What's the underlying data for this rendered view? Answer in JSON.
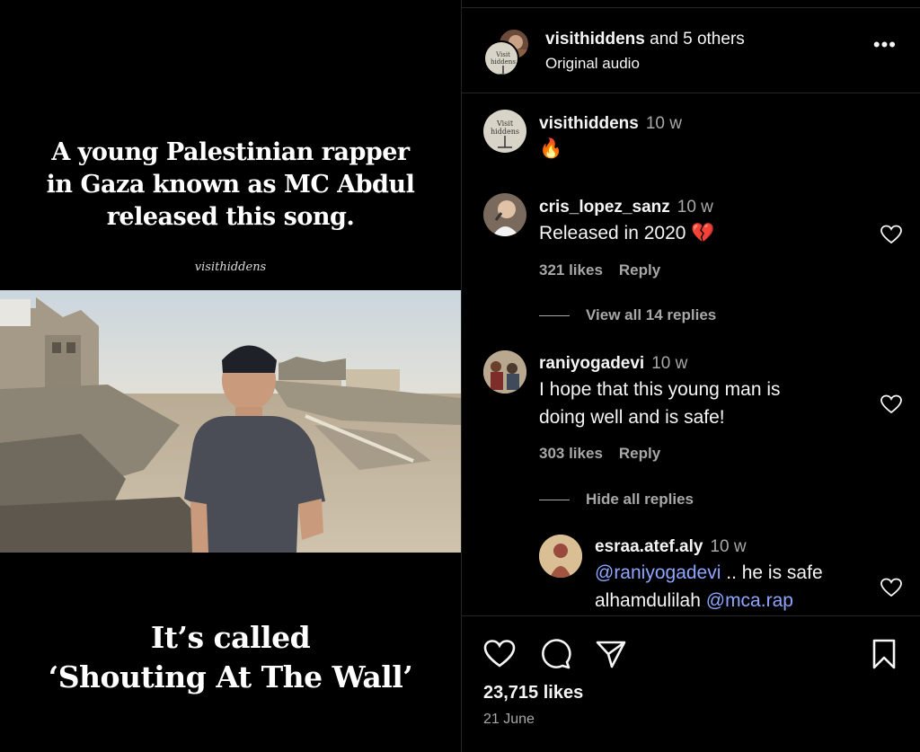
{
  "post": {
    "headline_lines": [
      "A young Palestinian rapper",
      "in Gaza known as MC Abdul",
      "released this song."
    ],
    "brand": "visithiddens",
    "footer_lines": [
      "It’s called",
      "‘Shouting At The Wall’"
    ]
  },
  "header": {
    "user": "visithiddens",
    "and_others": "and 5 others",
    "audio": "Original audio",
    "more_icon": "more-horizontal-icon"
  },
  "comments": [
    {
      "user": "visithiddens",
      "time": "10 w",
      "text": "🔥"
    },
    {
      "user": "cris_lopez_sanz",
      "time": "10 w",
      "text": "Released in 2020 💔",
      "likes": "321 likes",
      "reply": "Reply",
      "thread": "View all 14 replies"
    },
    {
      "user": "raniyogadevi",
      "time": "10 w",
      "text_lines": [
        "I hope that this young man is",
        "doing well and is safe!"
      ],
      "likes": "303 likes",
      "reply": "Reply",
      "thread": "Hide all replies"
    },
    {
      "user": "esraa.atef.aly",
      "time": "10 w",
      "mention1": "@raniyogadevi",
      "text_mid": " .. he is safe",
      "text_line2": "alhamdulilah ",
      "mention2": "@mca.rap"
    }
  ],
  "footer": {
    "likes": "23,715 likes",
    "date": "21 June",
    "icons": [
      "heart-icon",
      "comment-icon",
      "share-icon",
      "bookmark-icon"
    ]
  },
  "colors": {
    "background": "#000000",
    "text": "#f5f5f5",
    "muted": "#a8a8a8",
    "mention": "#8ea6ff",
    "divider": "#262626"
  }
}
